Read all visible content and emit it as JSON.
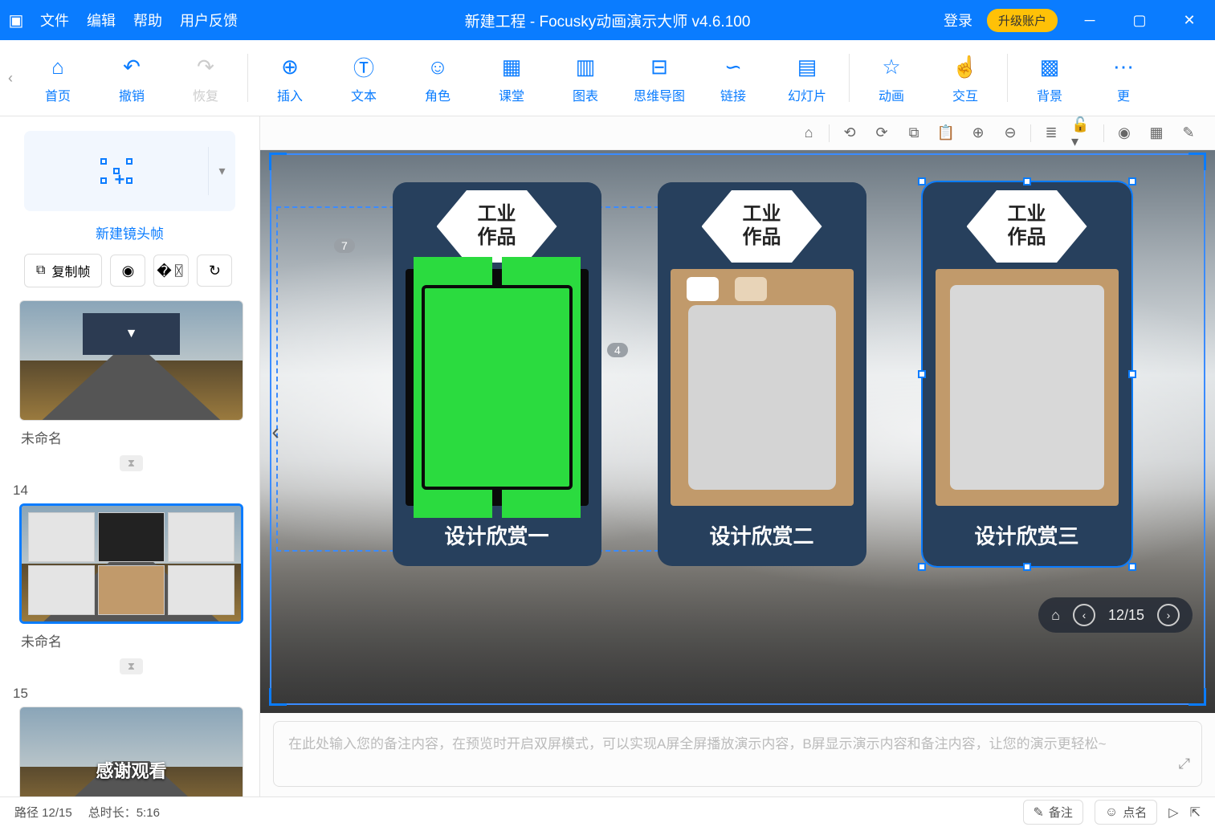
{
  "title_bar": {
    "menus": [
      "文件",
      "编辑",
      "帮助",
      "用户反馈"
    ],
    "title": "新建工程 - Focusky动画演示大师  v4.6.100",
    "login": "登录",
    "upgrade": "升级账户"
  },
  "toolbar": {
    "left": [
      {
        "id": "home",
        "label": "首页"
      },
      {
        "id": "undo",
        "label": "撤销"
      },
      {
        "id": "redo",
        "label": "恢复",
        "disabled": true
      }
    ],
    "main": [
      {
        "id": "insert",
        "label": "插入"
      },
      {
        "id": "text",
        "label": "文本"
      },
      {
        "id": "role",
        "label": "角色"
      },
      {
        "id": "class",
        "label": "课堂"
      },
      {
        "id": "chart",
        "label": "图表"
      },
      {
        "id": "mindmap",
        "label": "思维导图"
      },
      {
        "id": "link",
        "label": "链接"
      },
      {
        "id": "slide",
        "label": "幻灯片"
      },
      {
        "id": "anim",
        "label": "动画"
      },
      {
        "id": "interact",
        "label": "交互"
      },
      {
        "id": "bg",
        "label": "背景"
      },
      {
        "id": "more",
        "label": "更"
      }
    ]
  },
  "sidebar": {
    "new_frame": "新建镜头帧",
    "copy_frame": "复制帧",
    "slides": [
      {
        "num": "",
        "caption": "未命名",
        "type": "arrow"
      },
      {
        "num": "14",
        "caption": "未命名",
        "type": "collage",
        "selected": true
      },
      {
        "num": "15",
        "caption": "",
        "type": "thanks",
        "text": "感谢观看"
      }
    ]
  },
  "canvas": {
    "badge7": "7",
    "badge4": "4",
    "cards": [
      {
        "title": "工业\n作品",
        "caption": "设计欣赏一",
        "img": "green"
      },
      {
        "title": "工业\n作品",
        "caption": "设计欣赏二",
        "img": "wood"
      },
      {
        "title": "工业\n作品",
        "caption": "设计欣赏三",
        "img": "laptop",
        "selected": true
      }
    ],
    "nav_counter": "12/15"
  },
  "notes_placeholder": "在此处输入您的备注内容，在预览时开启双屏模式，可以实现A屏全屏播放演示内容，B屏显示演示内容和备注内容，让您的演示更轻松~",
  "status": {
    "path": "路径 12/15",
    "duration": "总时长：5:16",
    "notes_btn": "备注",
    "roll_btn": "点名"
  }
}
